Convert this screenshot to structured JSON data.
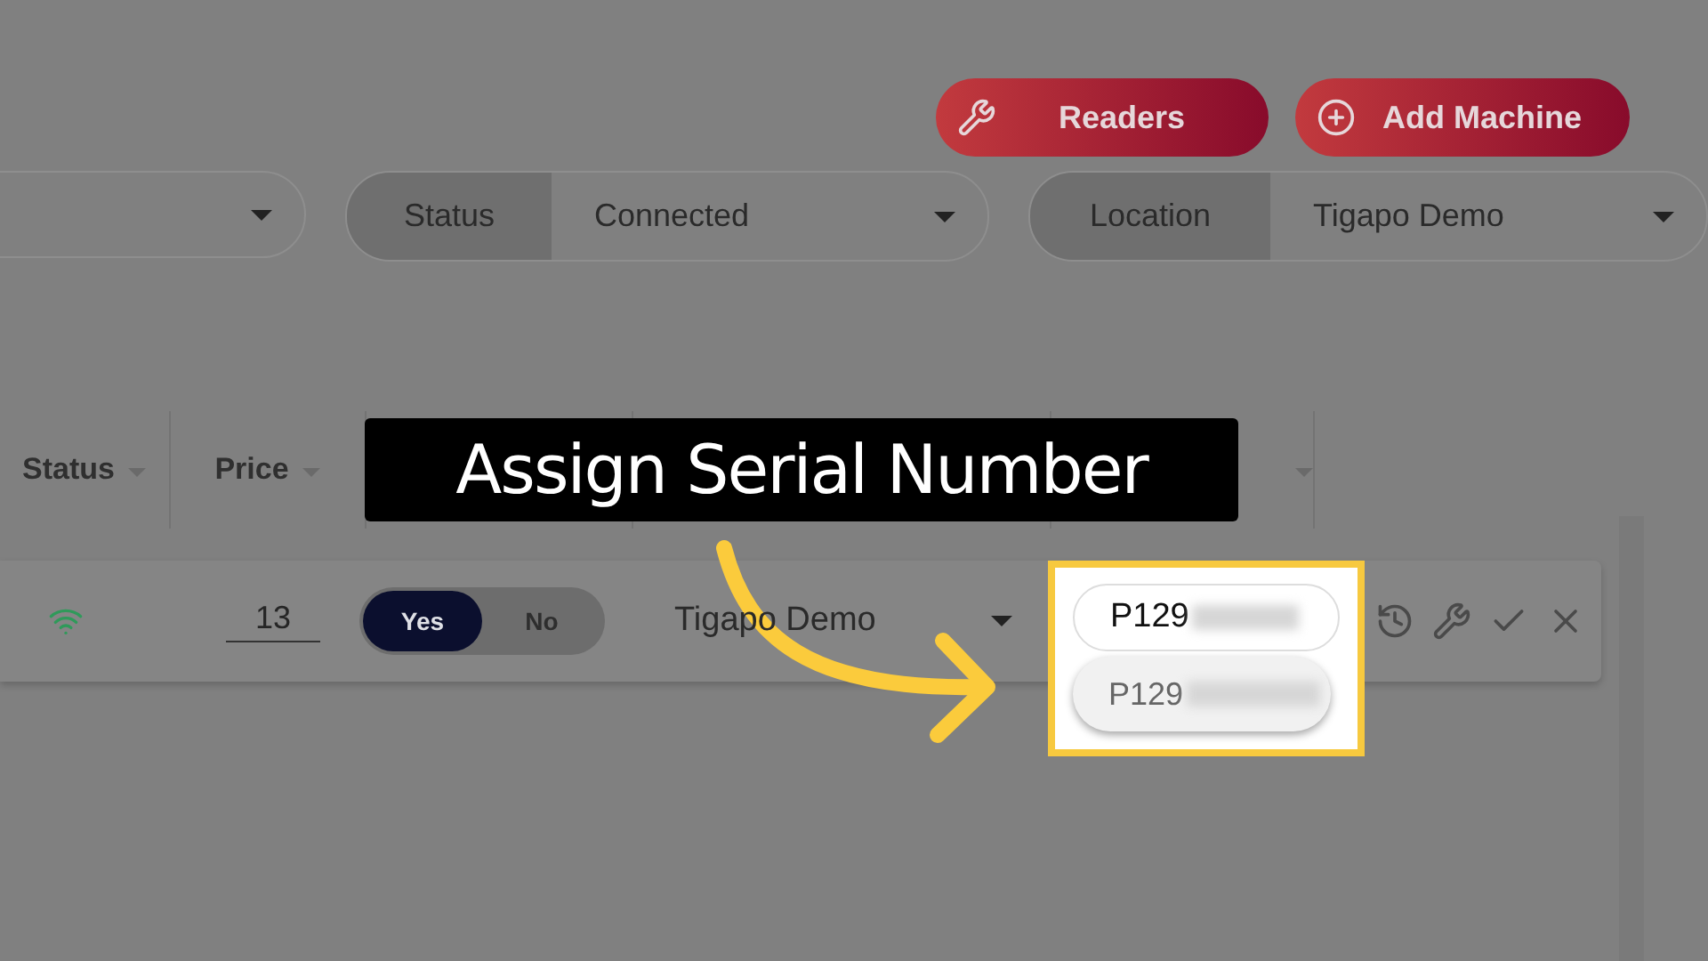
{
  "toolbar": {
    "buttons": [
      {
        "label": "Readers"
      },
      {
        "label": "Add Machine"
      }
    ]
  },
  "filters": [
    {
      "kind": "partial"
    },
    {
      "kind": "labeled",
      "label": "Status",
      "value": "Connected"
    },
    {
      "kind": "labeled",
      "label": "Location",
      "value": "Tigapo Demo"
    }
  ],
  "table": {
    "columns": [
      "Status",
      "Price"
    ],
    "row": {
      "price": "13",
      "toggle": [
        {
          "label": "Yes",
          "selected": true
        },
        {
          "label": "No",
          "selected": false
        }
      ],
      "location": "Tigapo Demo",
      "serial": {
        "value": "P129",
        "suggestions": [
          "P129"
        ]
      }
    }
  },
  "annotation": {
    "label": "Assign Serial Number"
  }
}
